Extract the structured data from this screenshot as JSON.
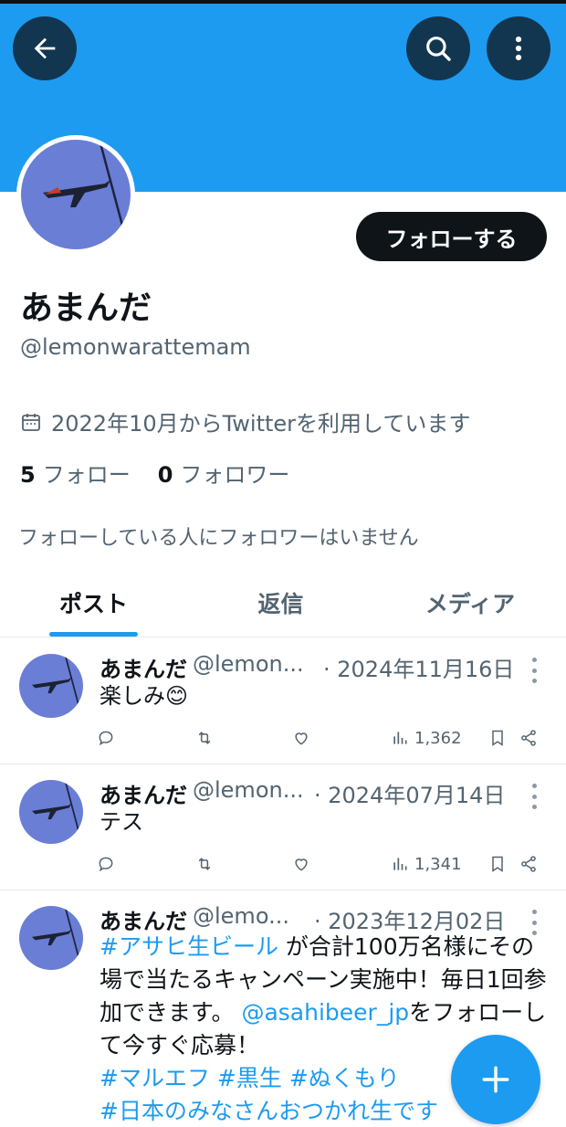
{
  "header": {
    "back_icon": "arrow-left-icon",
    "search_icon": "search-icon",
    "more_icon": "more-vertical-icon",
    "banner_color": "#1d9bf0"
  },
  "profile": {
    "avatar_icon": "airplane-avatar",
    "follow_label": "フォローする",
    "name": "あまんだ",
    "handle": "@lemonwarattemam",
    "joined_icon": "calendar-icon",
    "joined": "2022年10月からTwitterを利用しています",
    "following_count": "5",
    "following_label": "フォロー",
    "followers_count": "0",
    "followers_label": "フォロワー",
    "no_common_followers": "フォローしている人にフォロワーはいません"
  },
  "tabs": [
    {
      "label": "ポスト",
      "active": true
    },
    {
      "label": "返信",
      "active": false
    },
    {
      "label": "メディア",
      "active": false
    }
  ],
  "posts": [
    {
      "name": "あまんだ",
      "handle": "@lemon...",
      "date": "· 2024年11月16日",
      "text": "楽しみ😊",
      "views": "1,362"
    },
    {
      "name": "あまんだ",
      "handle": "@lemon...",
      "date": "· 2024年07月14日",
      "text": "テス",
      "views": "1,341"
    },
    {
      "name": "あまんだ",
      "handle": "@lemo...",
      "date": "· 2023年12月02日",
      "hashtag1": "#アサヒ生ビール",
      "text1": " が合計100万名様にその場で当たるキャンペーン実施中！毎日1回参加できます。 ",
      "mention": "@asahibeer_jp",
      "text2": "をフォローして今すぐ応募！",
      "hashtag2": "#マルエフ",
      "hashtag3": "#黒生",
      "hashtag4": "#ぬくもり",
      "hashtag5": "#日本のみなさんおつかれ生です"
    }
  ],
  "fab": {
    "icon": "plus-icon"
  },
  "colors": {
    "accent": "#1d9bf0",
    "text": "#0f1419",
    "muted": "#536471"
  }
}
